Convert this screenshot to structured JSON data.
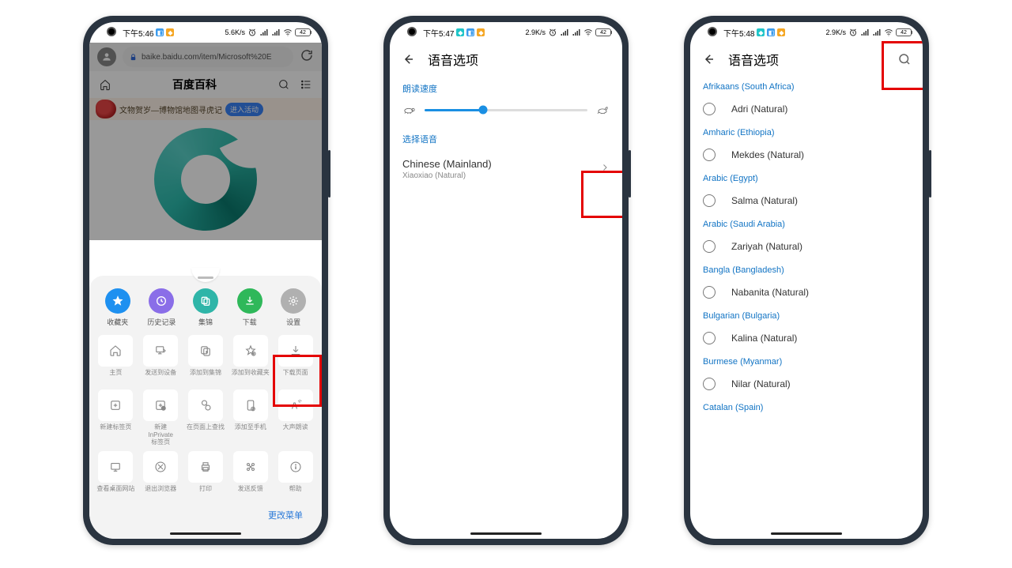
{
  "status": {
    "time1": "下午5:46",
    "time2": "下午5:47",
    "time3": "下午5:48",
    "net": "2.9K/s",
    "net1": "5.6K/s",
    "batt": "42"
  },
  "phone1": {
    "url": "baike.baidu.com/item/Microsoft%20E",
    "pageTitle": "百度百科",
    "banner": "文物贺岁—博物馆地图寻虎记",
    "bannerBtn": "进入活动",
    "quick": [
      {
        "label": "收藏夹"
      },
      {
        "label": "历史记录"
      },
      {
        "label": "集锦"
      },
      {
        "label": "下载"
      },
      {
        "label": "设置"
      }
    ],
    "tools": [
      {
        "label": "主页"
      },
      {
        "label": "发送到设备"
      },
      {
        "label": "添加到集锦"
      },
      {
        "label": "添加到收藏夹"
      },
      {
        "label": "下载页面"
      },
      {
        "label": "新建标签页"
      },
      {
        "label": "新建\nInPrivate\n标签页"
      },
      {
        "label": "在页面上查找"
      },
      {
        "label": "添加至手机"
      },
      {
        "label": "大声朗读"
      },
      {
        "label": "查看桌面网站"
      },
      {
        "label": "退出浏览器"
      },
      {
        "label": "打印"
      },
      {
        "label": "发送反馈"
      },
      {
        "label": "帮助"
      }
    ],
    "footer": "更改菜单"
  },
  "phone2": {
    "title": "语音选项",
    "speed": "朗读速度",
    "selectVoice": "选择语音",
    "voiceName": "Chinese (Mainland)",
    "voiceSub": "Xiaoxiao (Natural)"
  },
  "phone3": {
    "title": "语音选项",
    "groups": [
      {
        "header": "Afrikaans (South Africa)",
        "items": [
          "Adri (Natural)"
        ]
      },
      {
        "header": "Amharic (Ethiopia)",
        "items": [
          "Mekdes (Natural)"
        ]
      },
      {
        "header": "Arabic (Egypt)",
        "items": [
          "Salma (Natural)"
        ]
      },
      {
        "header": "Arabic (Saudi Arabia)",
        "items": [
          "Zariyah (Natural)"
        ]
      },
      {
        "header": "Bangla (Bangladesh)",
        "items": [
          "Nabanita (Natural)"
        ]
      },
      {
        "header": "Bulgarian (Bulgaria)",
        "items": [
          "Kalina (Natural)"
        ]
      },
      {
        "header": "Burmese (Myanmar)",
        "items": [
          "Nilar (Natural)"
        ]
      },
      {
        "header": "Catalan (Spain)",
        "items": []
      }
    ]
  }
}
